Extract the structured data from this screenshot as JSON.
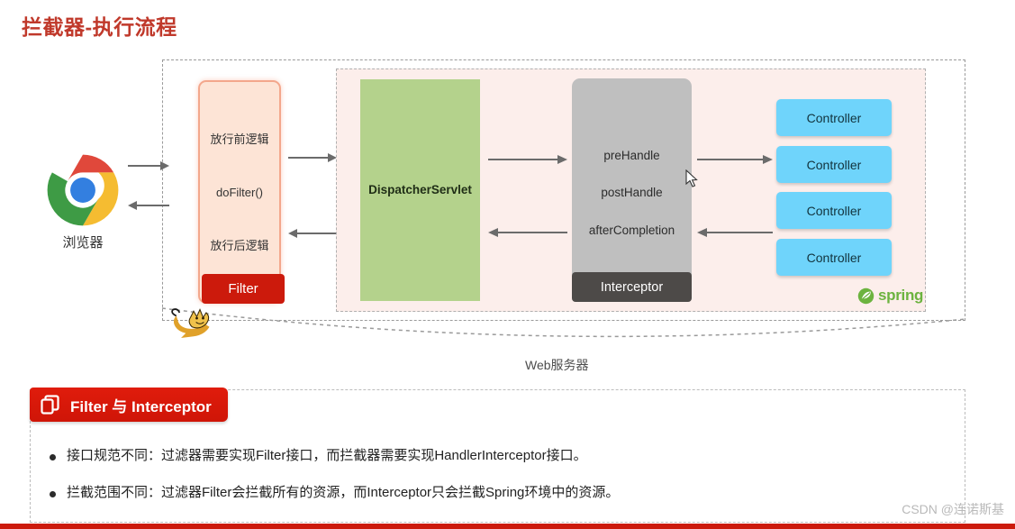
{
  "title": "拦截器-执行流程",
  "diagram": {
    "server_label": "Web服务器",
    "browser": {
      "label": "浏览器",
      "icon": "chrome-icon"
    },
    "tomcat_icon": "tomcat-icon",
    "filter": {
      "before_logic": "放行前逻辑",
      "method": "doFilter()",
      "after_logic": "放行后逻辑",
      "tag": "Filter"
    },
    "dispatcher": {
      "label": "DispatcherServlet"
    },
    "interceptor": {
      "pre": "preHandle",
      "post": "postHandle",
      "after": "afterCompletion",
      "tag": "Interceptor"
    },
    "controllers": [
      "Controller",
      "Controller",
      "Controller",
      "Controller"
    ],
    "spring_logo_text": "spring"
  },
  "bottom": {
    "banner_title": "Filter 与 Interceptor",
    "banner_icon": "windows-cards-icon",
    "bullets": [
      "接口规范不同：过滤器需要实现Filter接口，而拦截器需要实现HandlerInterceptor接口。",
      "拦截范围不同：过滤器Filter会拦截所有的资源，而Interceptor只会拦截Spring环境中的资源。"
    ]
  },
  "watermark": "CSDN @连诺斯基",
  "colors": {
    "title_red": "#c0392b",
    "banner_red": "#cf1507",
    "filter_fill": "#fde4d6",
    "dispatcher_green": "#b4d28c",
    "interceptor_gray": "#bfbfbf",
    "controller_blue": "#6fd4fb",
    "spring_green": "#6cb33f"
  }
}
